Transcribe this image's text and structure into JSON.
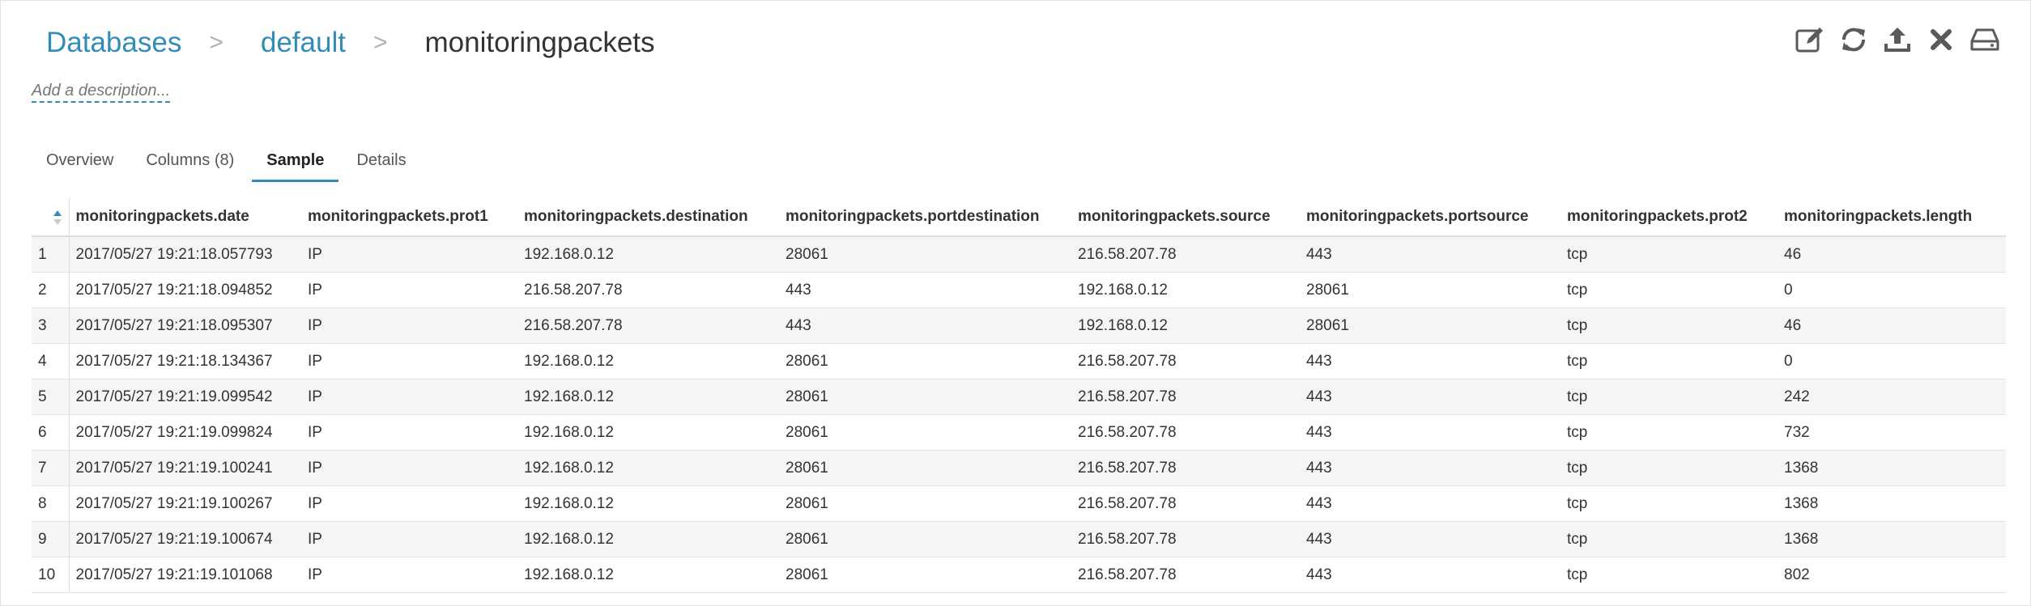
{
  "breadcrumb": {
    "databases": "Databases",
    "sep1": ">",
    "db": "default",
    "sep2": ">",
    "table": "monitoringpackets"
  },
  "toolbar": {
    "icons": [
      "edit-icon",
      "refresh-icon",
      "upload-icon",
      "close-icon",
      "storage-icon"
    ]
  },
  "description": {
    "placeholder": "Add a description..."
  },
  "tabs": [
    {
      "label": "Overview",
      "active": false
    },
    {
      "label": "Columns (8)",
      "active": false
    },
    {
      "label": "Sample",
      "active": true
    },
    {
      "label": "Details",
      "active": false
    }
  ],
  "sample": {
    "columns": [
      "monitoringpackets.date",
      "monitoringpackets.prot1",
      "monitoringpackets.destination",
      "monitoringpackets.portdestination",
      "monitoringpackets.source",
      "monitoringpackets.portsource",
      "monitoringpackets.prot2",
      "monitoringpackets.length"
    ],
    "rows": [
      [
        "1",
        "2017/05/27 19:21:18.057793",
        "IP",
        "192.168.0.12",
        "28061",
        "216.58.207.78",
        "443",
        "tcp",
        "46"
      ],
      [
        "2",
        "2017/05/27 19:21:18.094852",
        "IP",
        "216.58.207.78",
        "443",
        "192.168.0.12",
        "28061",
        "tcp",
        "0"
      ],
      [
        "3",
        "2017/05/27 19:21:18.095307",
        "IP",
        "216.58.207.78",
        "443",
        "192.168.0.12",
        "28061",
        "tcp",
        "46"
      ],
      [
        "4",
        "2017/05/27 19:21:18.134367",
        "IP",
        "192.168.0.12",
        "28061",
        "216.58.207.78",
        "443",
        "tcp",
        "0"
      ],
      [
        "5",
        "2017/05/27 19:21:19.099542",
        "IP",
        "192.168.0.12",
        "28061",
        "216.58.207.78",
        "443",
        "tcp",
        "242"
      ],
      [
        "6",
        "2017/05/27 19:21:19.099824",
        "IP",
        "192.168.0.12",
        "28061",
        "216.58.207.78",
        "443",
        "tcp",
        "732"
      ],
      [
        "7",
        "2017/05/27 19:21:19.100241",
        "IP",
        "192.168.0.12",
        "28061",
        "216.58.207.78",
        "443",
        "tcp",
        "1368"
      ],
      [
        "8",
        "2017/05/27 19:21:19.100267",
        "IP",
        "192.168.0.12",
        "28061",
        "216.58.207.78",
        "443",
        "tcp",
        "1368"
      ],
      [
        "9",
        "2017/05/27 19:21:19.100674",
        "IP",
        "192.168.0.12",
        "28061",
        "216.58.207.78",
        "443",
        "tcp",
        "1368"
      ],
      [
        "10",
        "2017/05/27 19:21:19.101068",
        "IP",
        "192.168.0.12",
        "28061",
        "216.58.207.78",
        "443",
        "tcp",
        "802"
      ]
    ]
  },
  "colors": {
    "link": "#338bb8",
    "icon": "#5a5a5a",
    "row_alt": "#f5f5f5"
  }
}
